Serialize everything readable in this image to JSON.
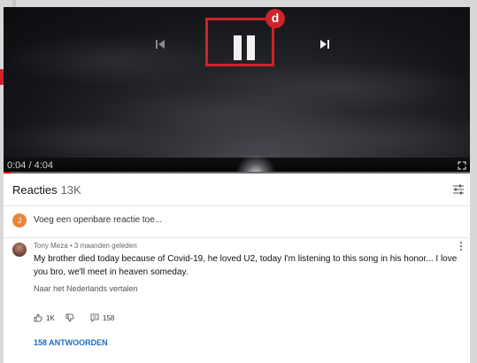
{
  "player": {
    "time_display": "0:04 / 4:04",
    "progress_fraction": 0.016,
    "badge_label": "d"
  },
  "comments_panel": {
    "title": "Reacties",
    "count": "13K",
    "add_comment_avatar_letter": "J",
    "add_comment_placeholder": "Voeg een openbare reactie toe...",
    "comment": {
      "author_meta": "Tony Meza • 3 maanden geleden",
      "text": "My brother died today because of Covid-19, he loved U2, today I'm listening to this song in his honor... I love you bro, we'll meet in heaven someday.",
      "translate_link": "Naar het Nederlands vertalen",
      "likes": "1K",
      "replies_count": "158",
      "replies_link": "158 ANTWOORDEN"
    }
  },
  "colors": {
    "accent_red": "#d0222a",
    "link_blue": "#1a6ec0",
    "progress_red": "#ff0000"
  }
}
